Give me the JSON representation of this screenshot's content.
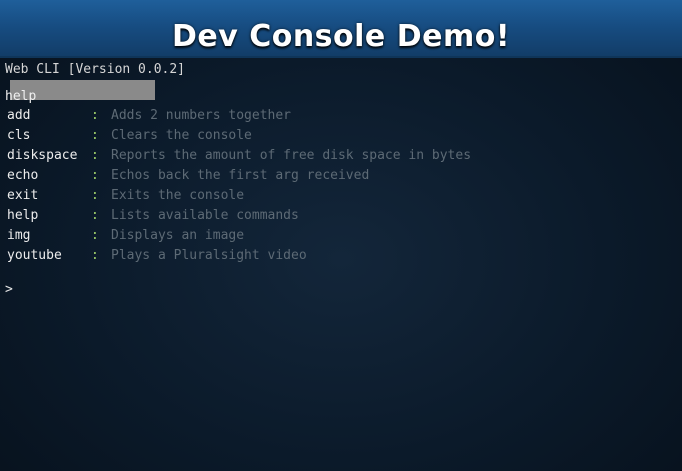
{
  "header": {
    "title": "Dev Console Demo!"
  },
  "console": {
    "version": "Web CLI [Version 0.0.2]",
    "echo": "help",
    "prompt": ">",
    "input_value": "",
    "commands": [
      {
        "name": "add",
        "sep": ":",
        "desc": "Adds 2 numbers together"
      },
      {
        "name": "cls",
        "sep": ":",
        "desc": "Clears the console"
      },
      {
        "name": "diskspace",
        "sep": ":",
        "desc": "Reports the amount of free disk space in bytes"
      },
      {
        "name": "echo",
        "sep": ":",
        "desc": "Echos back the first arg received"
      },
      {
        "name": "exit",
        "sep": ":",
        "desc": "Exits the console"
      },
      {
        "name": "help",
        "sep": ":",
        "desc": "Lists available commands"
      },
      {
        "name": "img",
        "sep": ":",
        "desc": "Displays an image"
      },
      {
        "name": "youtube",
        "sep": ":",
        "desc": "Plays a Pluralsight video"
      }
    ]
  },
  "colors": {
    "header": "#1b5690",
    "background": "#0b1a2a",
    "separator": "#9fd16b",
    "description": "#5d6a75",
    "command": "#ededed"
  }
}
